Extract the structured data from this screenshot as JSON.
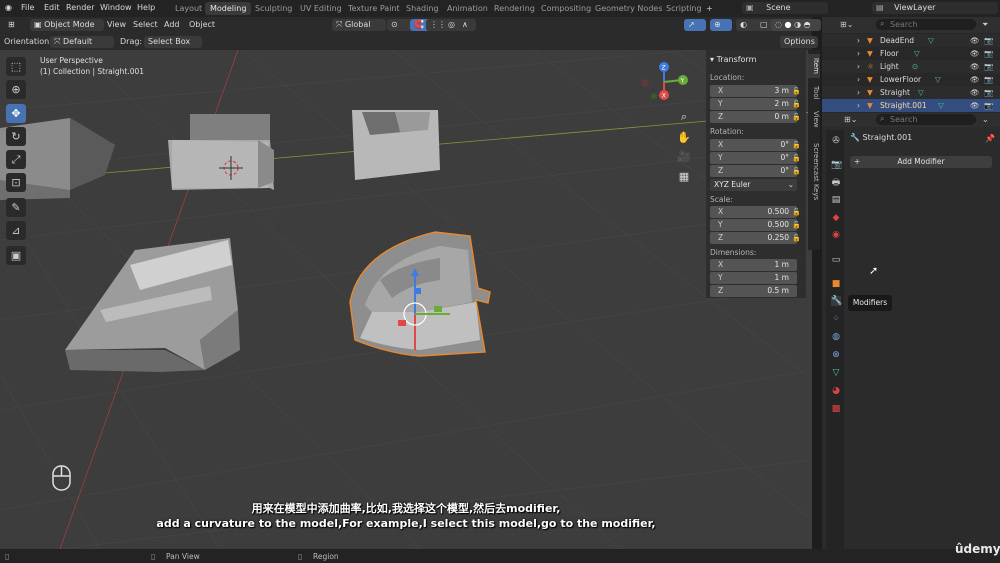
{
  "app": {
    "menu": [
      "File",
      "Edit",
      "Render",
      "Window",
      "Help"
    ],
    "workspaces": [
      "Layout",
      "Modeling",
      "Sculpting",
      "UV Editing",
      "Texture Paint",
      "Shading",
      "Animation",
      "Rendering",
      "Compositing",
      "Geometry Nodes",
      "Scripting"
    ],
    "active_workspace": "Modeling",
    "add_tab": "+",
    "scene": "Scene",
    "view_layer": "ViewLayer"
  },
  "header": {
    "mode": "Object Mode",
    "view": "View",
    "select": "Select",
    "add": "Add",
    "object": "Object",
    "transform_orientation": "Global",
    "options": "Options"
  },
  "toolsettings": {
    "orientation_label": "Orientation:",
    "orientation_value": "Default",
    "drag_label": "Drag:",
    "drag_value": "Select Box"
  },
  "viewport": {
    "perspective": "User Perspective",
    "collection": "(1) Collection | Straight.001",
    "gizmo_x": "X",
    "gizmo_y": "Y",
    "gizmo_z": "Z"
  },
  "npanel": {
    "title": "Transform",
    "location_label": "Location:",
    "location": [
      {
        "axis": "X",
        "value": "3 m"
      },
      {
        "axis": "Y",
        "value": "2 m"
      },
      {
        "axis": "Z",
        "value": "0 m"
      }
    ],
    "rotation_label": "Rotation:",
    "rotation": [
      {
        "axis": "X",
        "value": "0°"
      },
      {
        "axis": "Y",
        "value": "0°"
      },
      {
        "axis": "Z",
        "value": "0°"
      }
    ],
    "rotation_mode": "XYZ Euler",
    "scale_label": "Scale:",
    "scale": [
      {
        "axis": "X",
        "value": "0.500"
      },
      {
        "axis": "Y",
        "value": "0.500"
      },
      {
        "axis": "Z",
        "value": "0.250"
      }
    ],
    "dimensions_label": "Dimensions:",
    "dimensions": [
      {
        "axis": "X",
        "value": "1 m"
      },
      {
        "axis": "Y",
        "value": "1 m"
      },
      {
        "axis": "Z",
        "value": "0.5 m"
      }
    ],
    "tabs": [
      "Item",
      "Tool",
      "View",
      "Screencast Keys"
    ]
  },
  "outliner": {
    "search_placeholder": "Search",
    "items": [
      {
        "name": "DeadEnd",
        "selected": false
      },
      {
        "name": "Floor",
        "selected": false
      },
      {
        "name": "Light",
        "selected": false
      },
      {
        "name": "LowerFloor",
        "selected": false
      },
      {
        "name": "Straight",
        "selected": false
      },
      {
        "name": "Straight.001",
        "selected": true
      }
    ]
  },
  "properties": {
    "search_placeholder": "Search",
    "object_name": "Straight.001",
    "add_modifier": "Add Modifier",
    "tooltip": "Modifiers"
  },
  "status": {
    "pan_view": "Pan View",
    "region": "Region",
    "watermark": "ûdemy"
  },
  "subtitles": {
    "line1": "用来在模型中添加曲率,比如,我选择这个模型,然后去modifier,",
    "line2": "add a curvature to the model,For example,I select this model,go to the modifier,"
  },
  "colors": {
    "selection_orange": "#e8892e",
    "active_blue": "#4772b3",
    "axis_red": "#e04848",
    "axis_green": "#6aab3a",
    "axis_blue": "#3f7be0"
  }
}
